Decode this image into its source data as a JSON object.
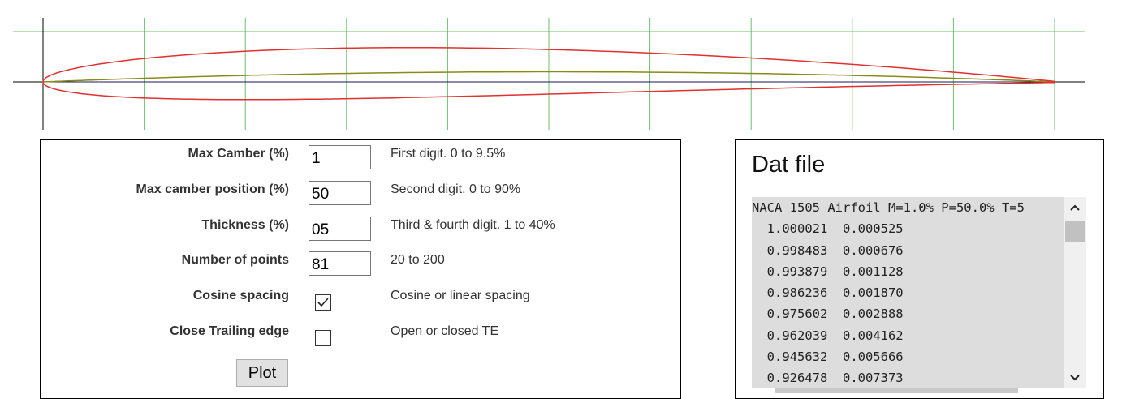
{
  "airfoil_plot": {
    "colors": {
      "grid": "#6dbf6d",
      "axes": "#000000",
      "chord": "#1a1a55",
      "camber": "#8a8a1a",
      "outline": "#e03030"
    },
    "max_camber": 0.01,
    "camber_position": 0.5,
    "thickness": 0.05
  },
  "form": {
    "fields": [
      {
        "label": "Max Camber (%)",
        "value": "1",
        "hint": "First digit. 0 to 9.5%"
      },
      {
        "label": "Max camber position (%)",
        "value": "50",
        "hint": "Second digit. 0 to 90%"
      },
      {
        "label": "Thickness (%)",
        "value": "05",
        "hint": "Third & fourth digit. 1 to 40%"
      },
      {
        "label": "Number of points",
        "value": "81",
        "hint": "20 to 200"
      }
    ],
    "checks": [
      {
        "label": "Cosine spacing",
        "checked": true,
        "hint": "Cosine or linear spacing"
      },
      {
        "label": "Close Trailing edge",
        "checked": false,
        "hint": "Open or closed TE"
      }
    ],
    "plot_label": "Plot"
  },
  "dat": {
    "title": "Dat file",
    "lines": [
      "NACA 1505 Airfoil M=1.0% P=50.0% T=5",
      "  1.000021  0.000525",
      "  0.998483  0.000676",
      "  0.993879  0.001128",
      "  0.986236  0.001870",
      "  0.975602  0.002888",
      "  0.962039  0.004162",
      "  0.945632  0.005666",
      "  0.926478  0.007373"
    ],
    "scroll_up_icon": "chevron-up-icon",
    "scroll_down_icon": "chevron-down-icon"
  }
}
